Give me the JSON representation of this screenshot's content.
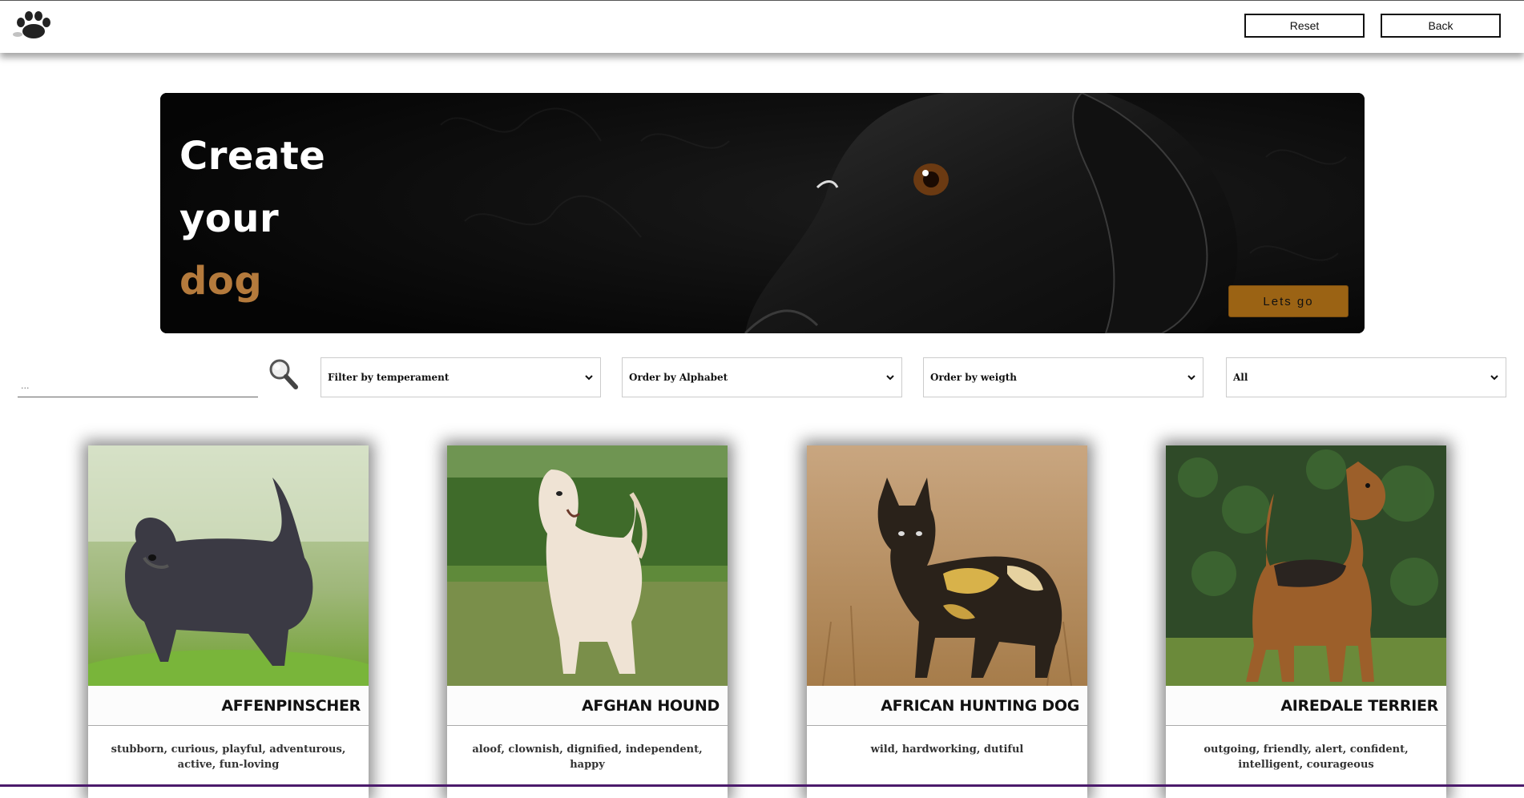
{
  "header": {
    "logo_icon": "paw-icon",
    "reset_label": "Reset",
    "back_label": "Back"
  },
  "hero": {
    "title_line1": "Create",
    "title_line2": "your",
    "title_line3": "dog",
    "accent_color": "#b47a3c",
    "button_label": "Lets go",
    "button_color": "#9b6314"
  },
  "filters": {
    "search_placeholder": "...",
    "search_icon": "search-icon",
    "temperament_selected": "Filter by temperament",
    "alphabet_selected": "Order by Alphabet",
    "weight_selected": "Order by weigth",
    "source_selected": "All"
  },
  "cards": [
    {
      "name": "AFFENPINSCHER",
      "temperament": "stubborn, curious, playful, adventurous, active, fun-loving"
    },
    {
      "name": "AFGHAN HOUND",
      "temperament": "aloof, clownish, dignified, independent, happy"
    },
    {
      "name": "AFRICAN HUNTING DOG",
      "temperament": "wild, hardworking, dutiful"
    },
    {
      "name": "AIREDALE TERRIER",
      "temperament": "outgoing, friendly, alert, confident, intelligent, courageous"
    }
  ]
}
